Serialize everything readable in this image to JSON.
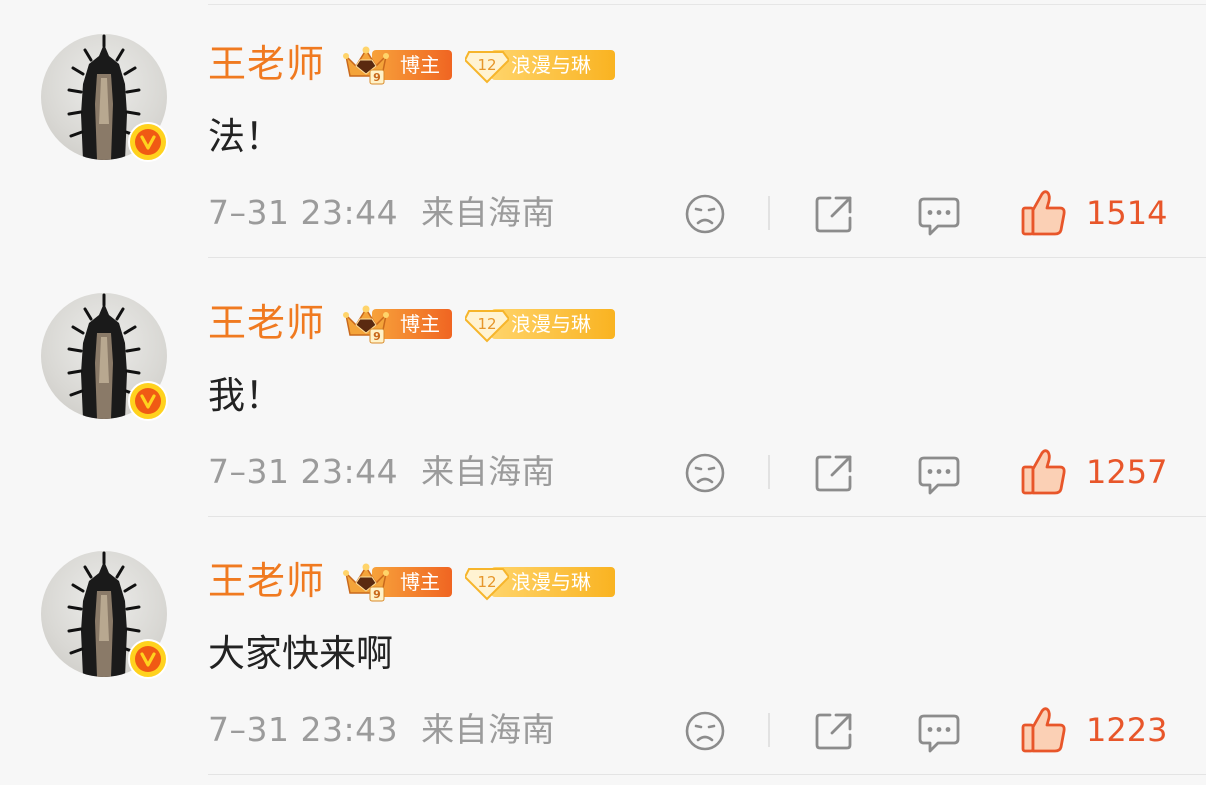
{
  "comments": [
    {
      "username": "王老师",
      "badge_blogger": "博主",
      "badge_fan_level": "12",
      "badge_fan_name": "浪漫与琳",
      "content": "法！",
      "time": "7–31 23:44",
      "location": "来自海南",
      "likes": "1514"
    },
    {
      "username": "王老师",
      "badge_blogger": "博主",
      "badge_fan_level": "12",
      "badge_fan_name": "浪漫与琳",
      "content": "我！",
      "time": "7–31 23:44",
      "location": "来自海南",
      "likes": "1257"
    },
    {
      "username": "王老师",
      "badge_blogger": "博主",
      "badge_fan_level": "12",
      "badge_fan_name": "浪漫与琳",
      "content": "大家快来啊",
      "time": "7–31 23:43",
      "location": "来自海南",
      "likes": "1223"
    }
  ],
  "icons": [
    "avatar",
    "verified-v-icon",
    "crown-icon",
    "fan-diamond-icon",
    "dislike-face-icon",
    "share-icon",
    "reply-icon",
    "thumbs-up-icon"
  ],
  "colors": {
    "username": "#f07a20",
    "like": "#e8562a",
    "meta": "#9b9b9b",
    "verified": "#ffd21e"
  }
}
